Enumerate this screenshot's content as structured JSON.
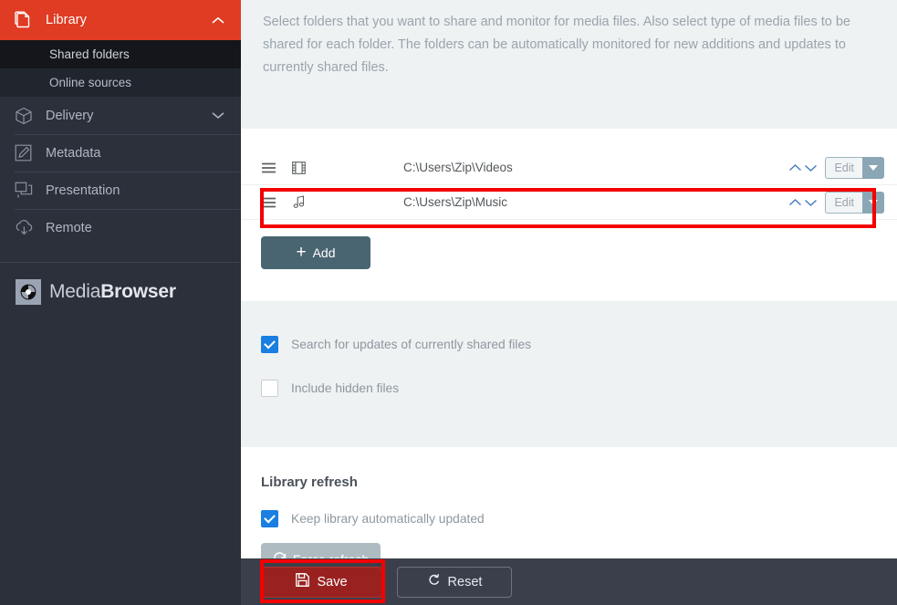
{
  "sidebar": {
    "group": {
      "label": "Library",
      "icon": "library-copy-icon",
      "chevron": "chevron-up-icon",
      "expanded": true,
      "accent_color": "#e03b23",
      "subitems": [
        {
          "label": "Shared folders",
          "active": true
        },
        {
          "label": "Online sources",
          "active": false
        }
      ]
    },
    "items": [
      {
        "label": "Delivery",
        "icon": "box-icon",
        "chevron": "chevron-down-icon"
      },
      {
        "label": "Metadata",
        "icon": "pencil-square-icon",
        "chevron": ""
      },
      {
        "label": "Presentation",
        "icon": "windows-stack-icon",
        "chevron": ""
      },
      {
        "label": "Remote",
        "icon": "cloud-download-icon",
        "chevron": ""
      }
    ],
    "brand": {
      "name_light": "Media",
      "name_bold": "Browser",
      "logo_icon": "mediabrowser-logo-icon"
    }
  },
  "main": {
    "intro_text": "Select folders that you want to share and monitor for media files. Also select type of media files to be shared for each folder. The folders can be automatically monitored for new additions and updates to currently shared files.",
    "folders": [
      {
        "path": "C:\\Users\\Zip\\Videos",
        "type_icon": "film-strip-icon",
        "handle_icon": "drag-handle-icon",
        "up_icon": "chevron-up-icon",
        "down_icon": "chevron-down-icon",
        "edit_label": "Edit",
        "caret_icon": "caret-down-icon",
        "highlighted": false
      },
      {
        "path": "C:\\Users\\Zip\\Music",
        "type_icon": "music-note-icon",
        "handle_icon": "drag-handle-icon",
        "up_icon": "chevron-up-icon",
        "down_icon": "chevron-down-icon",
        "edit_label": "Edit",
        "caret_icon": "caret-down-icon",
        "highlighted": true
      }
    ],
    "add_button": {
      "label": "Add",
      "icon": "plus-icon"
    },
    "options": [
      {
        "label": "Search for updates of currently shared files",
        "checked": true
      },
      {
        "label": "Include hidden files",
        "checked": false
      }
    ],
    "refresh_section": {
      "title": "Library refresh",
      "option": {
        "label": "Keep library automatically updated",
        "checked": true
      },
      "force_button": {
        "label": "Force refresh",
        "icon": "refresh-icon"
      }
    }
  },
  "footer": {
    "save": {
      "label": "Save",
      "icon": "floppy-disk-icon",
      "color": "#992220"
    },
    "reset": {
      "label": "Reset",
      "icon": "reset-arrow-icon"
    }
  },
  "annotations": {
    "highlight_color": "#f40000",
    "boxes": [
      "music-folder-row",
      "save-button"
    ]
  }
}
